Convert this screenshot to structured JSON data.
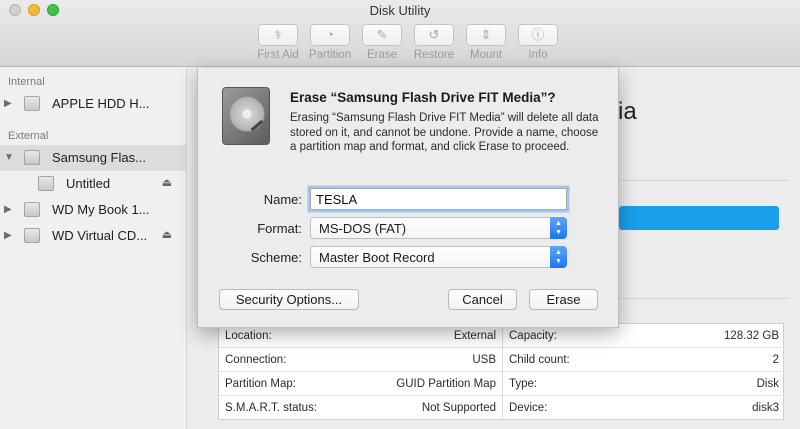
{
  "window": {
    "title": "Disk Utility"
  },
  "toolbar": {
    "buttons": [
      {
        "label": "First Aid",
        "icon": "stethoscope-icon",
        "glyph": "⚕"
      },
      {
        "label": "Partition",
        "icon": "partition-icon",
        "glyph": "◔"
      },
      {
        "label": "Erase",
        "icon": "erase-icon",
        "glyph": "✎"
      },
      {
        "label": "Restore",
        "icon": "restore-icon",
        "glyph": "↺"
      },
      {
        "label": "Mount",
        "icon": "mount-icon",
        "glyph": "⇕"
      },
      {
        "label": "Info",
        "icon": "info-icon",
        "glyph": "ⓘ"
      }
    ]
  },
  "sidebar": {
    "internal_label": "Internal",
    "external_label": "External",
    "items": [
      {
        "name": "APPLE HDD H...",
        "eject": ""
      },
      {
        "name": "Samsung Flas...",
        "eject": ""
      },
      {
        "name": "Untitled",
        "eject": "⏏"
      },
      {
        "name": "WD My Book 1...",
        "eject": ""
      },
      {
        "name": "WD Virtual CD...",
        "eject": "⏏"
      }
    ]
  },
  "background": {
    "title_fragment": "ia"
  },
  "sheet": {
    "title": "Erase “Samsung Flash Drive FIT Media”?",
    "message": "Erasing “Samsung Flash Drive FIT Media” will delete all data stored on it, and cannot be undone. Provide a name, choose a partition map and format, and click Erase to proceed.",
    "name_label": "Name:",
    "name_value": "TESLA",
    "format_label": "Format:",
    "format_value": "MS-DOS (FAT)",
    "scheme_label": "Scheme:",
    "scheme_value": "Master Boot Record",
    "security_button": "Security Options...",
    "cancel_button": "Cancel",
    "erase_button": "Erase"
  },
  "info": {
    "left": [
      {
        "key": "Location:",
        "value": "External"
      },
      {
        "key": "Connection:",
        "value": "USB"
      },
      {
        "key": "Partition Map:",
        "value": "GUID Partition Map"
      },
      {
        "key": "S.M.A.R.T. status:",
        "value": "Not Supported"
      }
    ],
    "right": [
      {
        "key": "Capacity:",
        "value": "128.32 GB"
      },
      {
        "key": "Child count:",
        "value": "2"
      },
      {
        "key": "Type:",
        "value": "Disk"
      },
      {
        "key": "Device:",
        "value": "disk3"
      }
    ]
  },
  "colors": {
    "accent": "#1b76f2",
    "usage_bar": "#19a0ec",
    "focus_ring": "#9ec9f1"
  }
}
